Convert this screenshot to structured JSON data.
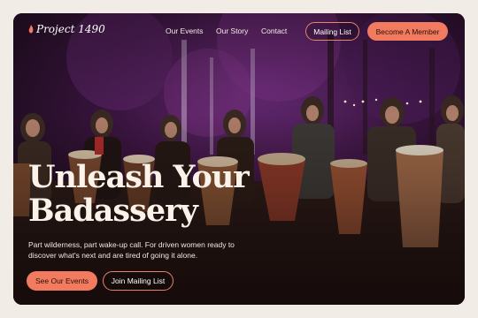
{
  "brand": {
    "name": "Project 1490",
    "accent": "#f27a5e"
  },
  "nav": {
    "links": [
      "Our Events",
      "Our Story",
      "Contact"
    ],
    "mailing_label": "Mailing List",
    "member_label": "Become A Member"
  },
  "hero": {
    "title_line1": "Unleash Your",
    "title_line2": "Badassery",
    "subtitle": "Part wilderness, part wake-up call. For driven women ready to discover what's next and are tired of going it alone.",
    "primary_cta": "See Our Events",
    "secondary_cta": "Join Mailing List"
  }
}
